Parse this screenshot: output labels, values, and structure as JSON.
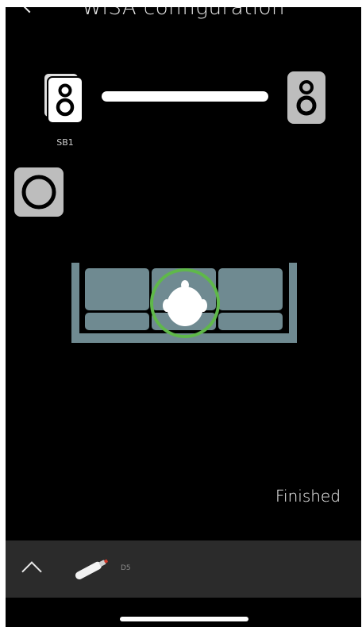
{
  "header": {
    "title": "WiSA configuration"
  },
  "speakers": {
    "left_label": "SB1"
  },
  "actions": {
    "finished_label": "Finished"
  },
  "bottom_bar": {
    "device_label": "D5"
  },
  "colors": {
    "background": "#000000",
    "speaker_active": "#ffffff",
    "speaker_inactive": "#bdbdbd",
    "sofa": "#6f8a91",
    "listener_ring": "#5fb84a",
    "bottom_bar": "#2b2b2b"
  },
  "icons": [
    "chevron-left-icon",
    "speaker-icon",
    "subwoofer-icon",
    "sofa-icon",
    "listener-head-icon",
    "chevron-up-icon",
    "remote-icon"
  ]
}
